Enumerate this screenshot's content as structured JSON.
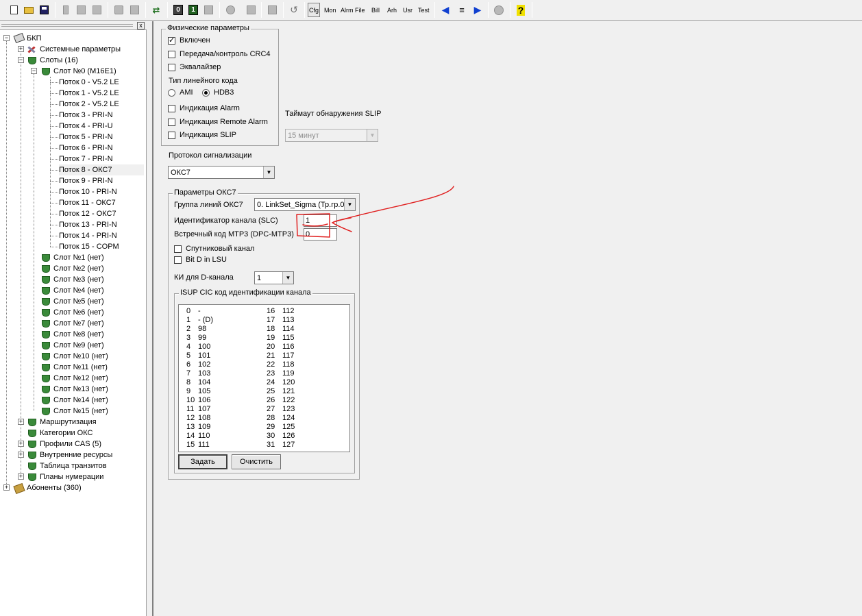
{
  "toolbar": {
    "text_buttons": [
      "Cfg",
      "Mon",
      "Alrm",
      "File",
      "Bill",
      "Arh",
      "Usr",
      "Test"
    ],
    "box0_label": "0",
    "box1_label": "1",
    "help_label": "?"
  },
  "tree": {
    "close_label": "x",
    "collapse_sign": "−",
    "expand_sign": "+",
    "items": [
      {
        "label": "БКП",
        "icon": "computer-icon"
      },
      {
        "label": "Системные параметры",
        "icon": "tools-icon"
      },
      {
        "label": "Слоты (16)",
        "icon": "shield-icon"
      },
      {
        "label": "Слот  №0 (M16E1)",
        "icon": "shield-icon"
      },
      {
        "label": "Поток 0 - V5.2 LE"
      },
      {
        "label": "Поток 1 - V5.2 LE"
      },
      {
        "label": "Поток 2 - V5.2 LE"
      },
      {
        "label": "Поток 3 - PRI-N"
      },
      {
        "label": "Поток 4 - PRI-U"
      },
      {
        "label": "Поток 5 - PRI-N"
      },
      {
        "label": "Поток 6 - PRI-N"
      },
      {
        "label": "Поток 7 - PRI-N"
      },
      {
        "label": "Поток 8 - ОКС7"
      },
      {
        "label": "Поток 9 - PRI-N"
      },
      {
        "label": "Поток 10 - PRI-N"
      },
      {
        "label": "Поток 11 - ОКС7"
      },
      {
        "label": "Поток 12 - ОКС7"
      },
      {
        "label": "Поток 13 - PRI-N"
      },
      {
        "label": "Поток 14 - PRI-N"
      },
      {
        "label": "Поток 15 - COPM"
      },
      {
        "label": "Слот  №1 (нет)",
        "icon": "shield-icon"
      },
      {
        "label": "Слот  №2 (нет)",
        "icon": "shield-icon"
      },
      {
        "label": "Слот  №3 (нет)",
        "icon": "shield-icon"
      },
      {
        "label": "Слот  №4 (нет)",
        "icon": "shield-icon"
      },
      {
        "label": "Слот  №5 (нет)",
        "icon": "shield-icon"
      },
      {
        "label": "Слот  №6 (нет)",
        "icon": "shield-icon"
      },
      {
        "label": "Слот  №7 (нет)",
        "icon": "shield-icon"
      },
      {
        "label": "Слот  №8 (нет)",
        "icon": "shield-icon"
      },
      {
        "label": "Слот  №9 (нет)",
        "icon": "shield-icon"
      },
      {
        "label": "Слот  №10 (нет)",
        "icon": "shield-icon"
      },
      {
        "label": "Слот  №11 (нет)",
        "icon": "shield-icon"
      },
      {
        "label": "Слот  №12 (нет)",
        "icon": "shield-icon"
      },
      {
        "label": "Слот  №13 (нет)",
        "icon": "shield-icon"
      },
      {
        "label": "Слот  №14 (нет)",
        "icon": "shield-icon"
      },
      {
        "label": "Слот  №15 (нет)",
        "icon": "shield-icon"
      },
      {
        "label": "Маршрутизация",
        "icon": "shield-icon"
      },
      {
        "label": "Категории ОКС",
        "icon": "shield-icon"
      },
      {
        "label": "Профили CAS (5)",
        "icon": "shield-icon"
      },
      {
        "label": "Внутренние ресурсы",
        "icon": "shield-icon"
      },
      {
        "label": "Таблица транзитов",
        "icon": "shield-icon"
      },
      {
        "label": "Планы нумерации",
        "icon": "shield-icon"
      },
      {
        "label": "Абоненты (360)",
        "icon": "book-icon"
      }
    ],
    "selected_label": "Поток 8 - ОКС7"
  },
  "physical": {
    "title": "Физические параметры",
    "enabled": {
      "label": "Включен",
      "checked": true
    },
    "crc4": {
      "label": "Передача/контроль CRC4",
      "checked": false
    },
    "equalizer": {
      "label": "Эквалайзер",
      "checked": false
    },
    "line_code_title": "Тип линейного кода",
    "ami_label": "AMI",
    "hdb3_label": "HDB3",
    "line_code_selected": "HDB3",
    "alarm": {
      "label": "Индикация Alarm",
      "checked": false
    },
    "remote_alarm": {
      "label": "Индикация Remote Alarm",
      "checked": false
    },
    "slip": {
      "label": "Индикация SLIP",
      "checked": false
    }
  },
  "slip_timeout": {
    "label": "Таймаут обнаружения SLIP",
    "value": "15 минут"
  },
  "signaling": {
    "label": "Протокол сигнализации",
    "value": "ОКС7"
  },
  "okc7": {
    "title": "Параметры ОКС7",
    "linkset": {
      "label": "Группа линий ОКС7",
      "value": "0. LinkSet_Sigma (Тр.гр.0"
    },
    "slc": {
      "label": "Идентификатор канала (SLC)",
      "value": "1"
    },
    "dpc": {
      "label": "Встречный код MTP3 (DPC-MTP3)",
      "value": "0"
    },
    "satellite": {
      "label": "Спутниковый канал",
      "checked": false
    },
    "bitd": {
      "label": "Bit D in LSU",
      "checked": false
    },
    "ki": {
      "label": "КИ для D-канала",
      "value": "1"
    },
    "cic_title": "ISUP CIC код идентификации канала",
    "cic_left": [
      [
        "0",
        "-"
      ],
      [
        "1",
        "- (D)"
      ],
      [
        "2",
        "98"
      ],
      [
        "3",
        "99"
      ],
      [
        "4",
        "100"
      ],
      [
        "5",
        "101"
      ],
      [
        "6",
        "102"
      ],
      [
        "7",
        "103"
      ],
      [
        "8",
        "104"
      ],
      [
        "9",
        "105"
      ],
      [
        "10",
        "106"
      ],
      [
        "11",
        "107"
      ],
      [
        "12",
        "108"
      ],
      [
        "13",
        "109"
      ],
      [
        "14",
        "110"
      ],
      [
        "15",
        "111"
      ]
    ],
    "cic_right": [
      [
        "16",
        "112"
      ],
      [
        "17",
        "113"
      ],
      [
        "18",
        "114"
      ],
      [
        "19",
        "115"
      ],
      [
        "20",
        "116"
      ],
      [
        "21",
        "117"
      ],
      [
        "22",
        "118"
      ],
      [
        "23",
        "119"
      ],
      [
        "24",
        "120"
      ],
      [
        "25",
        "121"
      ],
      [
        "26",
        "122"
      ],
      [
        "27",
        "123"
      ],
      [
        "28",
        "124"
      ],
      [
        "29",
        "125"
      ],
      [
        "30",
        "126"
      ],
      [
        "31",
        "127"
      ]
    ],
    "set_button": "Задать",
    "clear_button": "Очистить"
  },
  "colors": {
    "annotation": "#e02020",
    "selected_row": "#f0f0f0"
  }
}
